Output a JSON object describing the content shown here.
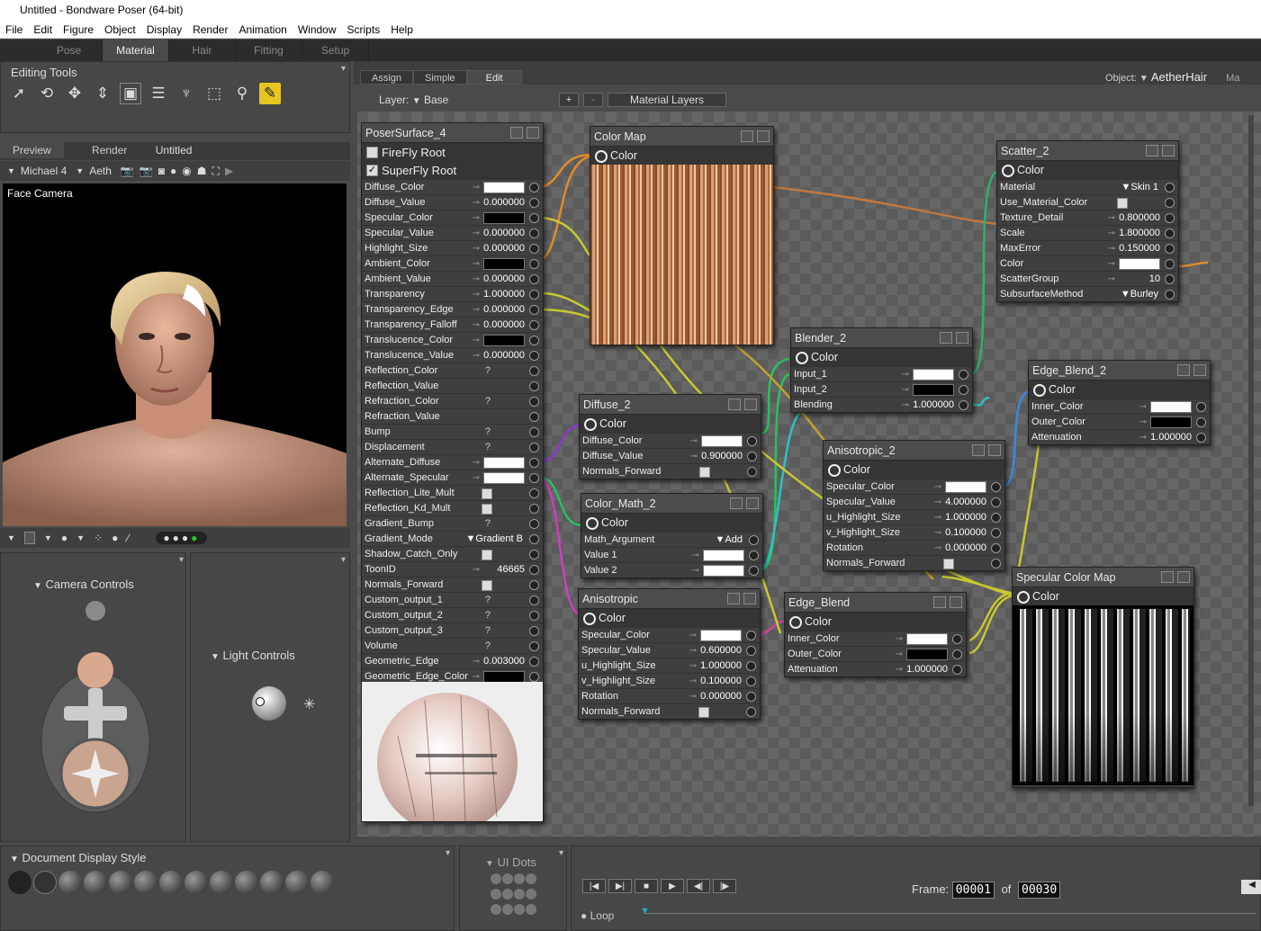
{
  "window": {
    "title": "Untitled - Bondware Poser (64-bit)"
  },
  "menu": [
    "File",
    "Edit",
    "Figure",
    "Object",
    "Display",
    "Render",
    "Animation",
    "Window",
    "Scripts",
    "Help"
  ],
  "rooms": [
    "Pose",
    "Material",
    "Hair",
    "Fitting",
    "Setup"
  ],
  "editing_tools": {
    "title": "Editing Tools"
  },
  "preview": {
    "tabs": [
      "Preview",
      "Render"
    ],
    "doc_title": "Untitled",
    "figure": "Michael 4",
    "actor": "Aeth",
    "camera": "Face Camera"
  },
  "camera_controls": {
    "title": "Camera Controls"
  },
  "light_controls": {
    "title": "Light Controls"
  },
  "doc_style": {
    "title": "Document Display Style"
  },
  "ui_dots": {
    "title": "UI Dots"
  },
  "timeline": {
    "frame_label": "Frame:",
    "frame": "00001",
    "of_label": "of",
    "total": "00030",
    "loop": "Loop"
  },
  "mat_tabs": [
    "Assign",
    "Simple",
    "Edit"
  ],
  "layer": {
    "label": "Layer:",
    "value": "Base",
    "plus": "+",
    "minus": "-",
    "layers_btn": "Material Layers"
  },
  "object": {
    "label": "Object:",
    "value": "AetherHair",
    "extra": "Ma"
  },
  "poser_surface": {
    "title": "PoserSurface_4",
    "roots": [
      "FireFly Root",
      "SuperFly Root"
    ],
    "rows": [
      [
        "Diffuse_Color",
        "sw:#ffffff"
      ],
      [
        "Diffuse_Value",
        "0.000000"
      ],
      [
        "Specular_Color",
        "sw:#000000"
      ],
      [
        "Specular_Value",
        "0.000000"
      ],
      [
        "Highlight_Size",
        "0.000000"
      ],
      [
        "Ambient_Color",
        "sw:#000000"
      ],
      [
        "Ambient_Value",
        "0.000000"
      ],
      [
        "Transparency",
        "1.000000"
      ],
      [
        "Transparency_Edge",
        "0.000000"
      ],
      [
        "Transparency_Falloff",
        "0.000000"
      ],
      [
        "Translucence_Color",
        "sw:#000000"
      ],
      [
        "Translucence_Value",
        "0.000000"
      ],
      [
        "Reflection_Color",
        "?"
      ],
      [
        "Reflection_Value",
        ""
      ],
      [
        "Refraction_Color",
        "?"
      ],
      [
        "Refraction_Value",
        ""
      ],
      [
        "Bump",
        "?"
      ],
      [
        "Displacement",
        "?"
      ],
      [
        "Alternate_Diffuse",
        "sw:#ffffff"
      ],
      [
        "Alternate_Specular",
        "sw:#ffffff"
      ],
      [
        "Reflection_Lite_Mult",
        "cb"
      ],
      [
        "Reflection_Kd_Mult",
        "cb"
      ],
      [
        "Gradient_Bump",
        "?"
      ],
      [
        "Gradient_Mode",
        "dd:Gradient B"
      ],
      [
        "Shadow_Catch_Only",
        "cb"
      ],
      [
        "ToonID",
        "46665"
      ],
      [
        "Normals_Forward",
        "cb"
      ],
      [
        "Custom_output_1",
        "?"
      ],
      [
        "Custom_output_2",
        "?"
      ],
      [
        "Custom_output_3",
        "?"
      ],
      [
        "Volume",
        "?"
      ],
      [
        "Geometric_Edge",
        "0.003000"
      ],
      [
        "Geometric_Edge_Color",
        "sw:#000000"
      ]
    ]
  },
  "nodes": {
    "color_map": {
      "title": "Color Map",
      "out": "Color"
    },
    "diffuse_2": {
      "title": "Diffuse_2",
      "out": "Color",
      "rows": [
        [
          "Diffuse_Color",
          "sw:#ffffff"
        ],
        [
          "Diffuse_Value",
          "0.900000"
        ],
        [
          "Normals_Forward",
          "cb"
        ]
      ]
    },
    "color_math_2": {
      "title": "Color_Math_2",
      "out": "Color",
      "rows": [
        [
          "Math_Argument",
          "dd:Add"
        ],
        [
          "Value 1",
          "sw:#ffffff"
        ],
        [
          "Value 2",
          "sw:#ffffff"
        ]
      ]
    },
    "anisotropic": {
      "title": "Anisotropic",
      "out": "Color",
      "rows": [
        [
          "Specular_Color",
          "sw:#ffffff"
        ],
        [
          "Specular_Value",
          "0.600000"
        ],
        [
          "u_Highlight_Size",
          "1.000000"
        ],
        [
          "v_Highlight_Size",
          "0.100000"
        ],
        [
          "Rotation",
          "0.000000"
        ],
        [
          "Normals_Forward",
          "cb"
        ]
      ]
    },
    "blender_2": {
      "title": "Blender_2",
      "out": "Color",
      "rows": [
        [
          "Input_1",
          "sw:#ffffff"
        ],
        [
          "Input_2",
          "sw:#000000"
        ],
        [
          "Blending",
          "1.000000"
        ]
      ]
    },
    "anisotropic_2": {
      "title": "Anisotropic_2",
      "out": "Color",
      "rows": [
        [
          "Specular_Color",
          "sw:#ffffff"
        ],
        [
          "Specular_Value",
          "4.000000"
        ],
        [
          "u_Highlight_Size",
          "1.000000"
        ],
        [
          "v_Highlight_Size",
          "0.100000"
        ],
        [
          "Rotation",
          "0.000000"
        ],
        [
          "Normals_Forward",
          "cb"
        ]
      ]
    },
    "edge_blend": {
      "title": "Edge_Blend",
      "out": "Color",
      "rows": [
        [
          "Inner_Color",
          "sw:#ffffff"
        ],
        [
          "Outer_Color",
          "sw:#000000"
        ],
        [
          "Attenuation",
          "1.000000"
        ]
      ]
    },
    "scatter_2": {
      "title": "Scatter_2",
      "out": "Color",
      "rows": [
        [
          "Material",
          "dd:Skin 1"
        ],
        [
          "Use_Material_Color",
          "cb"
        ],
        [
          "Texture_Detail",
          "0.800000"
        ],
        [
          "Scale",
          "1.800000"
        ],
        [
          "MaxError",
          "0.150000"
        ],
        [
          "Color",
          "sw:#ffffff"
        ],
        [
          "ScatterGroup",
          "10"
        ],
        [
          "SubsurfaceMethod",
          "dd:Burley"
        ]
      ]
    },
    "edge_blend_2": {
      "title": "Edge_Blend_2",
      "out": "Color",
      "rows": [
        [
          "Inner_Color",
          "sw:#ffffff"
        ],
        [
          "Outer_Color",
          "sw:#000000"
        ],
        [
          "Attenuation",
          "1.000000"
        ]
      ]
    },
    "specular_color_map": {
      "title": "Specular Color Map",
      "out": "Color"
    }
  }
}
